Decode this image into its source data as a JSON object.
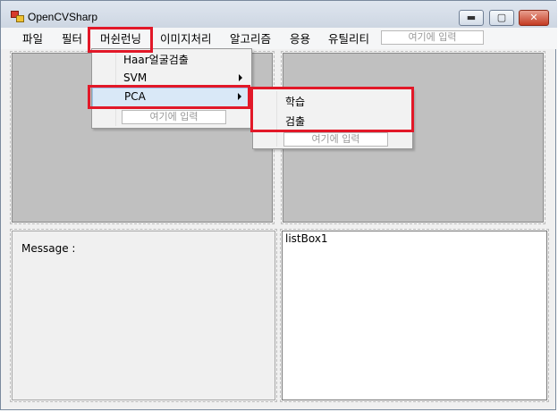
{
  "window": {
    "title": "OpenCVSharp"
  },
  "titlebar_buttons": {
    "minimize": "▬",
    "maximize": "▢",
    "close": "✕"
  },
  "menubar": {
    "items": [
      "파일",
      "필터",
      "머쉰런닝",
      "이미지처리",
      "알고리즘",
      "응용",
      "유틸리티"
    ],
    "input_placeholder": "여기에 입력"
  },
  "dropdown_main": {
    "items": [
      "Haar얼굴검출",
      "SVM",
      "PCA"
    ],
    "input_placeholder": "여기에 입력"
  },
  "dropdown_pca": {
    "items": [
      "학습",
      "검출"
    ],
    "input_placeholder": "여기에 입력"
  },
  "message_panel": {
    "label": "Message :"
  },
  "listbox": {
    "label": "listBox1"
  },
  "colors": {
    "highlight": "#e21828",
    "picture_bg": "#c0c0c0"
  },
  "icons": {
    "app": "opencv-app-icon",
    "submenu": "submenu-arrow-icon"
  }
}
